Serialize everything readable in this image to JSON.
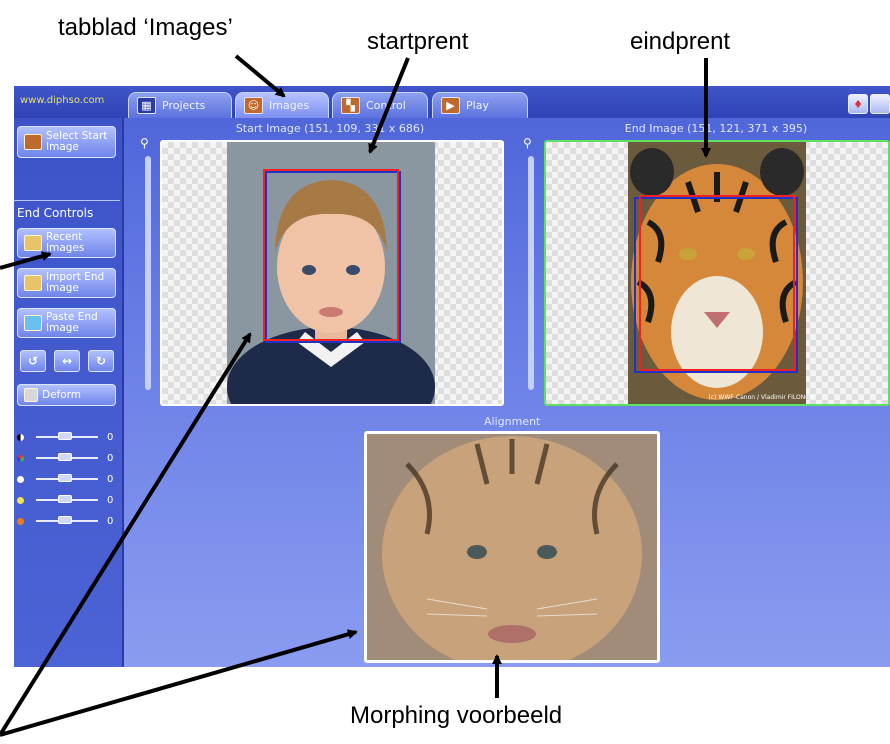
{
  "app": {
    "site": "www.diphso.com",
    "tabs": [
      {
        "label": "Projects",
        "icon": "grid-icon",
        "active": false
      },
      {
        "label": "Images",
        "icon": "portrait-icon",
        "active": true
      },
      {
        "label": "Control",
        "icon": "control-icon",
        "active": false
      },
      {
        "label": "Play",
        "icon": "play-icon",
        "active": false
      }
    ],
    "window_buttons": [
      {
        "icon": "help-icon",
        "glyph": "♦"
      },
      {
        "icon": "close-icon",
        "glyph": ""
      }
    ]
  },
  "sidebar": {
    "select_start": "Select Start Image",
    "section_label": "End Controls",
    "recent": "Recent Images",
    "import": "Import End Image",
    "paste": "Paste End Image",
    "rotate_left": "↺",
    "flip": "↔",
    "rotate_right": "↻",
    "deform": "Deform",
    "sliders": [
      {
        "name": "contrast",
        "color": "#ffffff",
        "value": "0"
      },
      {
        "name": "color",
        "color": "#5ad15a",
        "value": "0"
      },
      {
        "name": "brightness",
        "color": "#ffffff",
        "value": "0"
      },
      {
        "name": "gamma",
        "color": "#f2e34a",
        "value": "0"
      },
      {
        "name": "saturation",
        "color": "#f07a1a",
        "value": "0"
      }
    ]
  },
  "panes": {
    "start_title": "Start Image (151, 109, 331 x 686)",
    "end_title": "End Image (151, 121, 371 x 395)",
    "credit": "(c) WWF-Canon / Vladimir FILONOV",
    "alignment": "Alignment"
  },
  "annotations": {
    "tab_images": "tabblad ‘Images’",
    "start": "startprent",
    "end": "eindprent",
    "morph": "Morphing voorbeeld"
  }
}
